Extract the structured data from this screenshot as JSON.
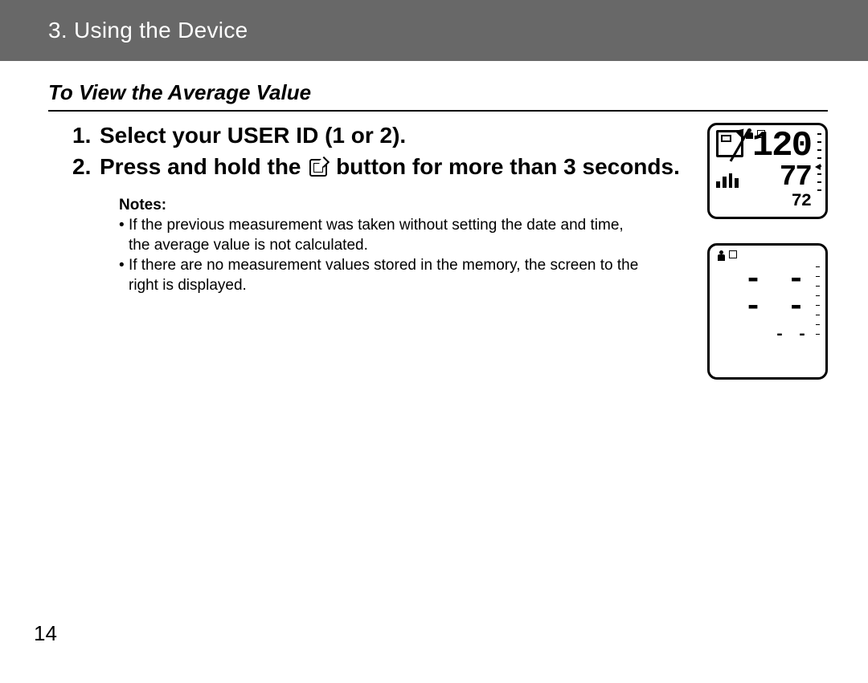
{
  "header": {
    "title": "3. Using the Device"
  },
  "section": {
    "title": "To View the Average Value"
  },
  "steps": [
    {
      "num": "1.",
      "text": "Select your USER ID (1 or 2)."
    },
    {
      "num": "2.",
      "text_before": "Press and hold the ",
      "text_after": " button for more than 3 seconds."
    }
  ],
  "notes": {
    "title": "Notes:",
    "items": [
      "If the previous measurement was taken without setting the date and time, the average value is not calculated.",
      "If there are no measurement values stored in the memory, the screen to the right is displayed."
    ]
  },
  "display1": {
    "sys": "120",
    "dia": "77",
    "pulse": "72"
  },
  "display2": {
    "sys": "- -",
    "dia": "- -",
    "pulse": "- -"
  },
  "page_number": "14"
}
